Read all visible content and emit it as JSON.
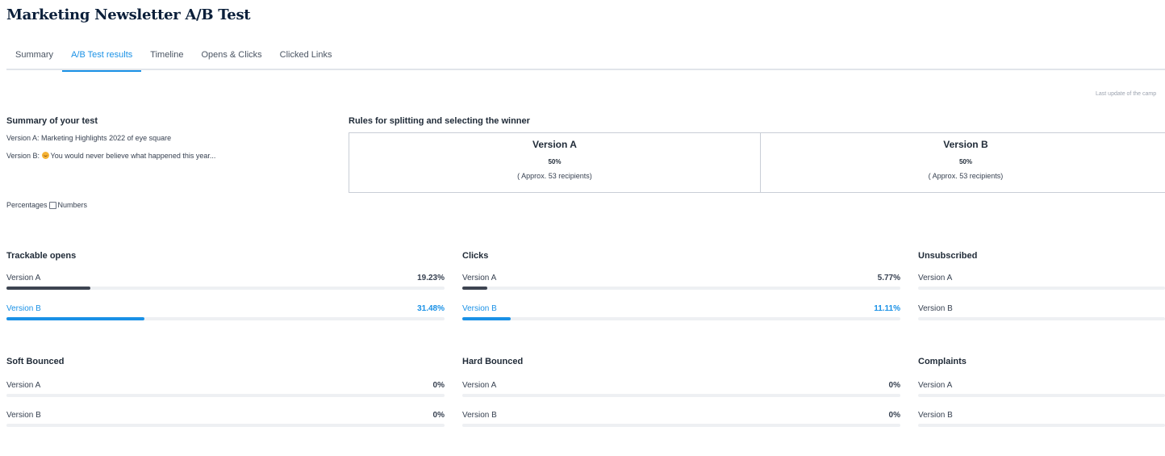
{
  "page": {
    "title": "Marketing Newsletter A/B Test"
  },
  "tabs": [
    {
      "label": "Summary",
      "active": false
    },
    {
      "label": "A/B Test results",
      "active": true
    },
    {
      "label": "Timeline",
      "active": false
    },
    {
      "label": "Opens & Clicks",
      "active": false
    },
    {
      "label": "Clicked Links",
      "active": false
    }
  ],
  "last_update": "Last update of the camp",
  "summary": {
    "title": "Summary of your test",
    "version_a": "Version A: Marketing Highlights 2022 of eye square",
    "version_b_prefix": "Version B: ",
    "version_b_emoji": "smiling-face-emoji",
    "version_b_text": "You would never believe what happened this year..."
  },
  "display_toggle": {
    "label_before": "Percentages",
    "label_after": "Numbers",
    "checked": false
  },
  "rules": {
    "title": "Rules for splitting and selecting the winner",
    "columns": [
      {
        "name": "Version A",
        "percent": "50%",
        "recipients": "( Approx. 53 recipients)"
      },
      {
        "name": "Version B",
        "percent": "50%",
        "recipients": "( Approx. 53 recipients)"
      }
    ]
  },
  "metrics": [
    {
      "title": "Trackable opens",
      "a_label": "Version A",
      "a_value": "19.23%",
      "a_fill": 0.1923,
      "b_label": "Version B",
      "b_value": "31.48%",
      "b_fill": 0.3148
    },
    {
      "title": "Clicks",
      "a_label": "Version A",
      "a_value": "5.77%",
      "a_fill": 0.0577,
      "b_label": "Version B",
      "b_value": "11.11%",
      "b_fill": 0.1111
    },
    {
      "title": "Unsubscribed",
      "a_label": "Version A",
      "a_value": "",
      "a_fill": 0,
      "b_label": "Version B",
      "b_value": "",
      "b_fill": 0
    },
    {
      "title": "Soft Bounced",
      "a_label": "Version A",
      "a_value": "0%",
      "a_fill": 0,
      "b_label": "Version B",
      "b_value": "0%",
      "b_fill": 0
    },
    {
      "title": "Hard Bounced",
      "a_label": "Version A",
      "a_value": "0%",
      "a_fill": 0,
      "b_label": "Version B",
      "b_value": "0%",
      "b_fill": 0
    },
    {
      "title": "Complaints",
      "a_label": "Version A",
      "a_value": "",
      "a_fill": 0,
      "b_label": "Version B",
      "b_value": "",
      "b_fill": 0
    }
  ],
  "colors": {
    "accent": "#1a91e6",
    "bar_a": "#3d4451",
    "track": "#eef0f3",
    "title": "#0b1f3a"
  }
}
